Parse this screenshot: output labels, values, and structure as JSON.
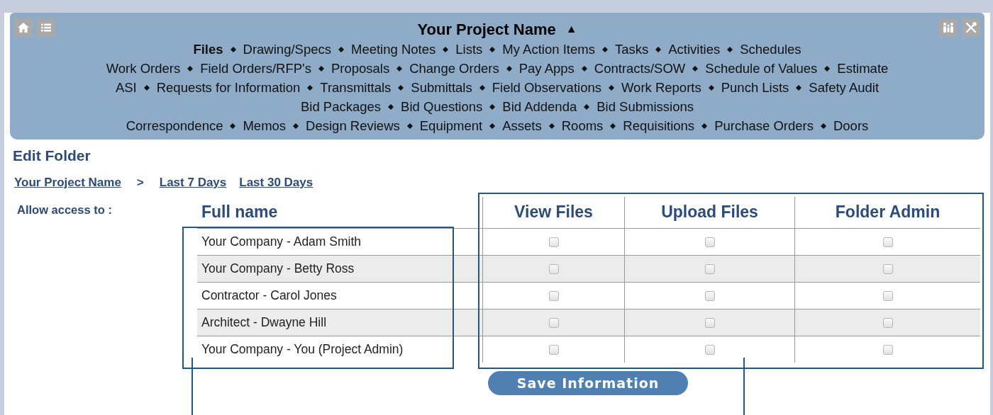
{
  "header": {
    "title": "Your Project Name",
    "collapse_glyph": "▲"
  },
  "nav_rows": [
    [
      {
        "label": "Files",
        "selected": true
      },
      {
        "label": "Drawing/Specs",
        "selected": false
      },
      {
        "label": "Meeting Notes",
        "selected": false
      },
      {
        "label": "Lists",
        "selected": false
      },
      {
        "label": "My Action Items",
        "selected": false
      },
      {
        "label": "Tasks",
        "selected": false
      },
      {
        "label": "Activities",
        "selected": false
      },
      {
        "label": "Schedules",
        "selected": false
      }
    ],
    [
      {
        "label": "Work Orders",
        "selected": false
      },
      {
        "label": "Field Orders/RFP's",
        "selected": false
      },
      {
        "label": "Proposals",
        "selected": false
      },
      {
        "label": "Change Orders",
        "selected": false
      },
      {
        "label": "Pay Apps",
        "selected": false
      },
      {
        "label": "Contracts/SOW",
        "selected": false
      },
      {
        "label": "Schedule of Values",
        "selected": false
      },
      {
        "label": "Estimate",
        "selected": false
      }
    ],
    [
      {
        "label": "ASI",
        "selected": false
      },
      {
        "label": "Requests for Information",
        "selected": false
      },
      {
        "label": "Transmittals",
        "selected": false
      },
      {
        "label": "Submittals",
        "selected": false
      },
      {
        "label": "Field Observations",
        "selected": false
      },
      {
        "label": "Work Reports",
        "selected": false
      },
      {
        "label": "Punch Lists",
        "selected": false
      },
      {
        "label": "Safety Audit",
        "selected": false
      }
    ],
    [
      {
        "label": "Bid Packages",
        "selected": false
      },
      {
        "label": "Bid Questions",
        "selected": false
      },
      {
        "label": "Bid Addenda",
        "selected": false
      },
      {
        "label": "Bid Submissions",
        "selected": false
      }
    ],
    [
      {
        "label": "Correspondence",
        "selected": false
      },
      {
        "label": "Memos",
        "selected": false
      },
      {
        "label": "Design Reviews",
        "selected": false
      },
      {
        "label": "Equipment",
        "selected": false
      },
      {
        "label": "Assets",
        "selected": false
      },
      {
        "label": "Rooms",
        "selected": false
      },
      {
        "label": "Requisitions",
        "selected": false
      },
      {
        "label": "Purchase Orders",
        "selected": false
      },
      {
        "label": "Doors",
        "selected": false
      }
    ]
  ],
  "page_title": "Edit Folder",
  "breadcrumb": {
    "project": "Your Project Name",
    "separator": ">",
    "links": [
      "Last 7 Days",
      "Last 30 Days"
    ]
  },
  "access_label": "Allow access to :",
  "table": {
    "columns": [
      "Full name",
      "View Files",
      "Upload Files",
      "Folder Admin"
    ],
    "rows": [
      {
        "name": "Your Company - Adam Smith",
        "permissions": [
          {
            "checked": false
          },
          {
            "checked": false
          },
          {
            "checked": false
          }
        ]
      },
      {
        "name": "Your Company - Betty Ross",
        "permissions": [
          {
            "checked": false
          },
          {
            "checked": false
          },
          {
            "checked": false
          }
        ]
      },
      {
        "name": "Contractor - Carol Jones",
        "permissions": [
          {
            "checked": false
          },
          {
            "checked": false
          },
          {
            "checked": false
          }
        ]
      },
      {
        "name": "Architect - Dwayne Hill",
        "permissions": [
          {
            "checked": false
          },
          {
            "checked": false
          },
          {
            "checked": false
          }
        ]
      },
      {
        "name": "Your Company - You (Project Admin)",
        "permissions": [
          {
            "checked": false
          },
          {
            "checked": false
          },
          {
            "checked": false
          }
        ]
      }
    ]
  },
  "save_button": "Save Information"
}
